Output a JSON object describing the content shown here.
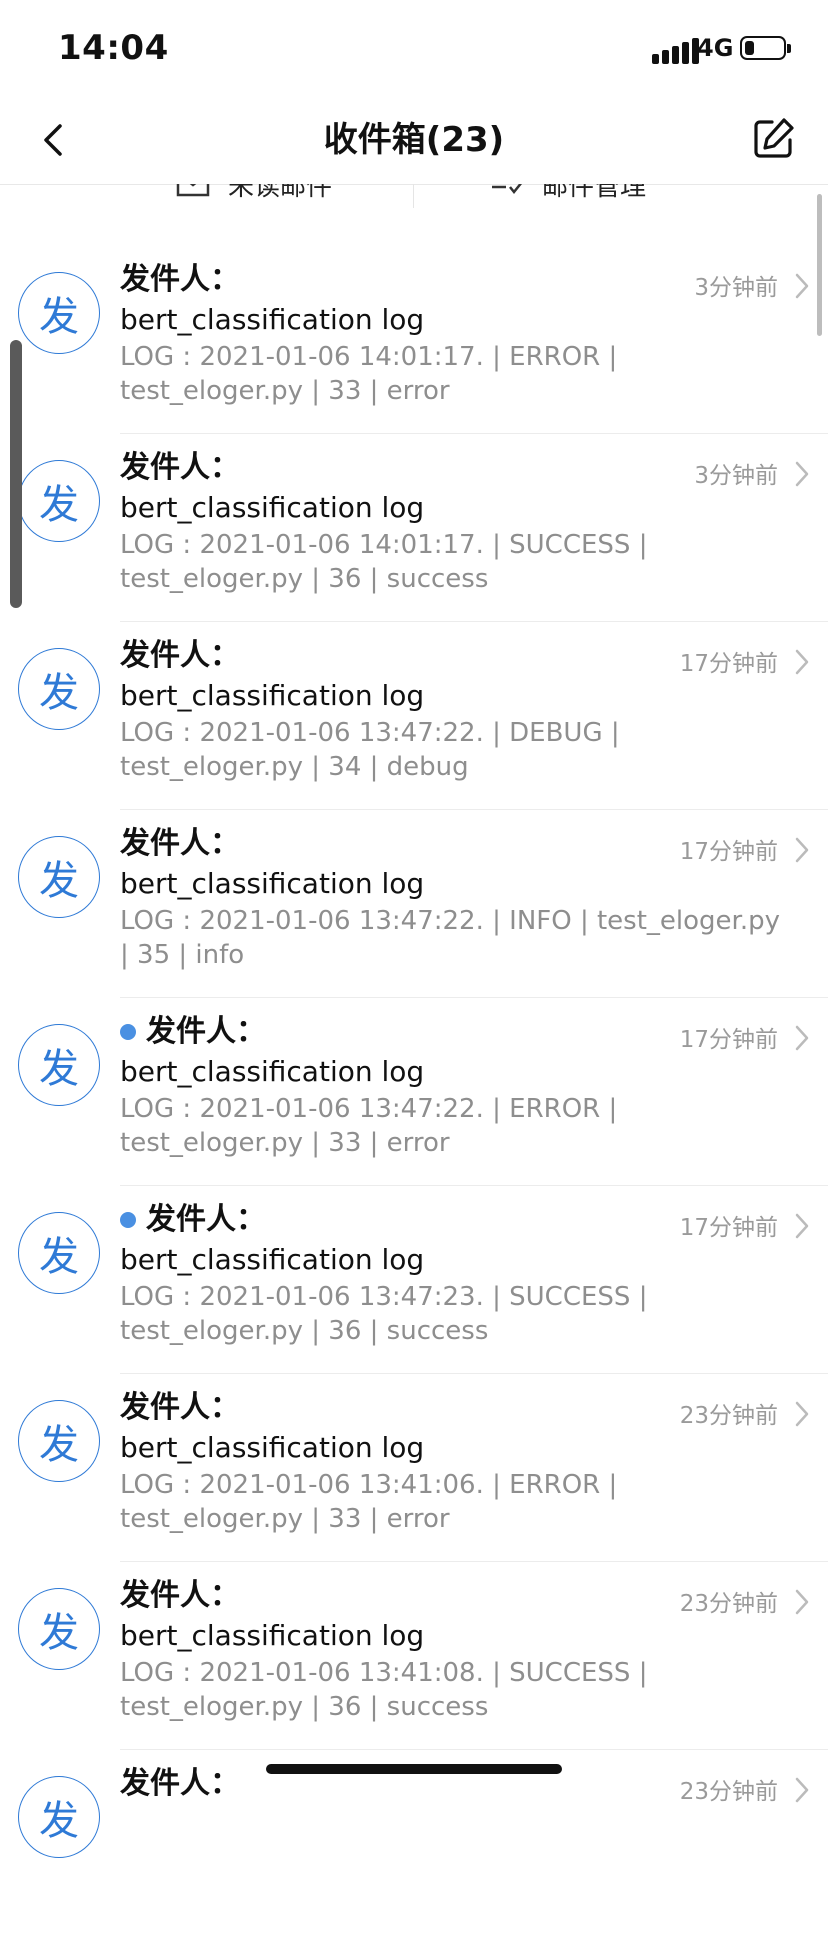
{
  "status_bar": {
    "time": "14:04",
    "network": "4G",
    "battery_level": 0.25
  },
  "nav": {
    "title": "收件箱(23)",
    "back_icon": "chevron-left-icon",
    "compose_icon": "edit-icon"
  },
  "filters": {
    "unread": "未读邮件",
    "manage": "邮件管理"
  },
  "colors": {
    "accent": "#2f7ad6",
    "unread_dot": "#4a90e2",
    "preview_text": "#8e8e8e",
    "time_text": "#9a9a9a"
  },
  "mails": [
    {
      "avatar": "发",
      "sender": "发件人：",
      "unread": false,
      "time": "3分钟前",
      "subject": "bert_classification log",
      "preview": "LOG : 2021-01-06 14:01:17. | ERROR | test_eloger.py | 33 | error"
    },
    {
      "avatar": "发",
      "sender": "发件人：",
      "unread": false,
      "time": "3分钟前",
      "subject": "bert_classification log",
      "preview": "LOG : 2021-01-06 14:01:17. | SUCCESS | test_eloger.py | 36 | success"
    },
    {
      "avatar": "发",
      "sender": "发件人：",
      "unread": false,
      "time": "17分钟前",
      "subject": "bert_classification log",
      "preview": "LOG : 2021-01-06 13:47:22. | DEBUG | test_eloger.py | 34 | debug"
    },
    {
      "avatar": "发",
      "sender": "发件人：",
      "unread": false,
      "time": "17分钟前",
      "subject": "bert_classification log",
      "preview": "LOG : 2021-01-06 13:47:22. | INFO | test_eloger.py | 35 | info"
    },
    {
      "avatar": "发",
      "sender": "发件人：",
      "unread": true,
      "time": "17分钟前",
      "subject": "bert_classification log",
      "preview": "LOG : 2021-01-06 13:47:22. | ERROR | test_eloger.py | 33 | error"
    },
    {
      "avatar": "发",
      "sender": "发件人：",
      "unread": true,
      "time": "17分钟前",
      "subject": "bert_classification log",
      "preview": "LOG : 2021-01-06 13:47:23. | SUCCESS | test_eloger.py | 36 | success"
    },
    {
      "avatar": "发",
      "sender": "发件人：",
      "unread": false,
      "time": "23分钟前",
      "subject": "bert_classification log",
      "preview": "LOG : 2021-01-06 13:41:06. | ERROR | test_eloger.py | 33 | error"
    },
    {
      "avatar": "发",
      "sender": "发件人：",
      "unread": false,
      "time": "23分钟前",
      "subject": "bert_classification log",
      "preview": "LOG : 2021-01-06 13:41:08. | SUCCESS | test_eloger.py | 36 | success"
    },
    {
      "avatar": "发",
      "sender": "发件人：",
      "unread": false,
      "time": "23分钟前",
      "subject": "",
      "preview": ""
    }
  ]
}
